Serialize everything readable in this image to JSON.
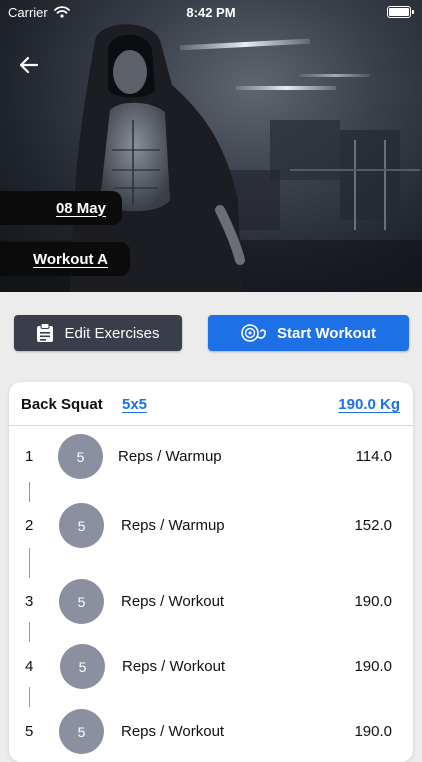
{
  "status_bar": {
    "carrier": "Carrier",
    "time": "8:42 PM"
  },
  "hero": {
    "date_tag": "08 May",
    "workout_tag": "Workout A"
  },
  "actions": {
    "edit_label": "Edit Exercises",
    "start_label": "Start Workout",
    "start_color": "#1d70e6",
    "edit_color": "#3a3e4a"
  },
  "exercise": {
    "name": "Back Squat",
    "scheme": "5x5",
    "weight": "190.0 Kg",
    "sets": [
      {
        "number": "1",
        "reps": "5",
        "type": "Reps / Warmup",
        "value": "114.0"
      },
      {
        "number": "2",
        "reps": "5",
        "type": "Reps / Warmup",
        "value": "152.0"
      },
      {
        "number": "3",
        "reps": "5",
        "type": "Reps / Workout",
        "value": "190.0"
      },
      {
        "number": "4",
        "reps": "5",
        "type": "Reps / Workout",
        "value": "190.0"
      },
      {
        "number": "5",
        "reps": "5",
        "type": "Reps / Workout",
        "value": "190.0"
      }
    ]
  }
}
